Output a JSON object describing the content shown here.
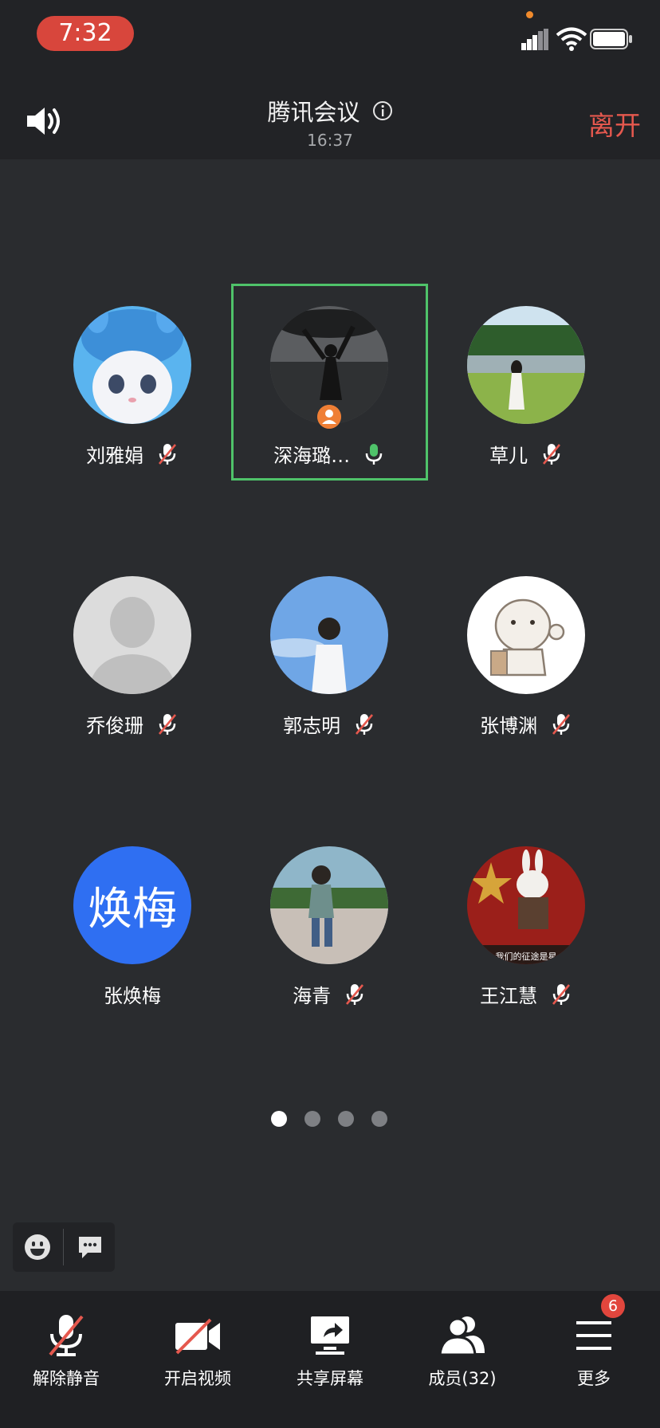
{
  "status_bar": {
    "time": "7:32"
  },
  "header": {
    "title": "腾讯会议",
    "clock": "16:37",
    "leave_label": "离开"
  },
  "participants": [
    {
      "name": "刘雅娟",
      "mic": "muted"
    },
    {
      "name": "深海璐…",
      "mic": "speaking",
      "host": true
    },
    {
      "name": "草儿",
      "mic": "muted"
    },
    {
      "name": "乔俊珊",
      "mic": "muted"
    },
    {
      "name": "郭志明",
      "mic": "muted"
    },
    {
      "name": "张博渊",
      "mic": "muted"
    },
    {
      "name": "张焕梅",
      "mic": "none",
      "avatar_text": "焕梅",
      "avatar_color": "#2f6ff2"
    },
    {
      "name": "海青",
      "mic": "muted"
    },
    {
      "name": "王江慧",
      "mic": "muted",
      "avatar_caption": "我们的征途是星"
    }
  ],
  "pagination": {
    "pages": 4,
    "current": 1
  },
  "toolbar": {
    "unmute_label": "解除静音",
    "video_label": "开启视频",
    "share_label": "共享屏幕",
    "members_label": "成员(32)",
    "more_label": "更多",
    "more_badge": "6"
  },
  "colors": {
    "accent_red": "#e5584e",
    "speaking_green": "#4fc36a",
    "host_orange": "#ef7f35",
    "background": "#2a2c2f"
  }
}
